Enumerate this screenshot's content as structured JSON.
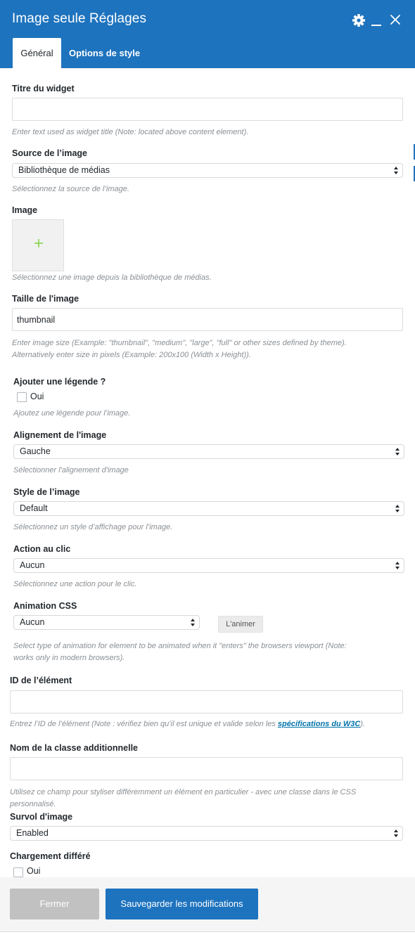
{
  "header": {
    "title": "Image seule Réglages",
    "tabs": [
      {
        "label": "Général",
        "active": true
      },
      {
        "label": "Options de style",
        "active": false
      }
    ],
    "icons": [
      "gear-icon",
      "minimize-icon",
      "close-icon"
    ],
    "accent_color": "#1e73be"
  },
  "fields": {
    "widget_title": {
      "label": "Titre du widget",
      "value": "",
      "help": "Enter text used as widget title (Note: located above content element)."
    },
    "image_source": {
      "label": "Source de l’image",
      "value": "Bibliothèque de médias",
      "help": "Sélectionnez la source de l’image."
    },
    "image": {
      "label": "Image",
      "help": "Sélectionnez une image depuis la bibliothèque de médias."
    },
    "image_size": {
      "label": "Taille de l'image",
      "value": "thumbnail",
      "help_line1": "Enter image size (Example: \"thumbnail\", \"medium\", \"large\", \"full\" or other sizes defined by theme).",
      "help_line2": "Alternatively enter size in pixels (Example: 200x100 (Width x Height))."
    },
    "add_caption": {
      "label": "Ajouter une légende ?",
      "option": "Oui",
      "checked": false,
      "help": "Ajoutez une légende pour l’image."
    },
    "alignment": {
      "label": "Alignement de l'image",
      "value": "Gauche",
      "help": "Sélectionner l'alignement d'image"
    },
    "image_style": {
      "label": "Style de l’image",
      "value": "Default",
      "help": "Sélectionnez un style d’affichage pour l’image."
    },
    "click_action": {
      "label": "Action au clic",
      "value": "Aucun",
      "help": "Sélectionnez une action pour le clic."
    },
    "css_animation": {
      "label": "Animation CSS",
      "value": "Aucun",
      "button": "L'animer",
      "help_line1": "Select type of animation for element to be animated when it \"enters\" the browsers viewport (Note:",
      "help_line2": "works only in modern browsers)."
    },
    "element_id": {
      "label": "ID de l’élément",
      "value": "",
      "help_prefix": "Entrez l’ID de l’élément (Note : vérifiez bien qu’il est unique et valide selon les ",
      "help_link": "spécifications du W3C",
      "help_suffix": ")."
    },
    "extra_class": {
      "label": "Nom de la classe additionnelle",
      "value": "",
      "help_line1": "Utilisez ce champ pour styliser différemment un élément en particulier - avec une classe dans le CSS",
      "help_line2": "personnalisé."
    },
    "image_hover": {
      "label": "Survol d'image",
      "value": "Enabled"
    },
    "lazy_load": {
      "label": "Chargement différé",
      "option": "Oui",
      "checked": false
    }
  },
  "footer": {
    "close_label": "Fermer",
    "save_label": "Sauvegarder les modifications"
  }
}
